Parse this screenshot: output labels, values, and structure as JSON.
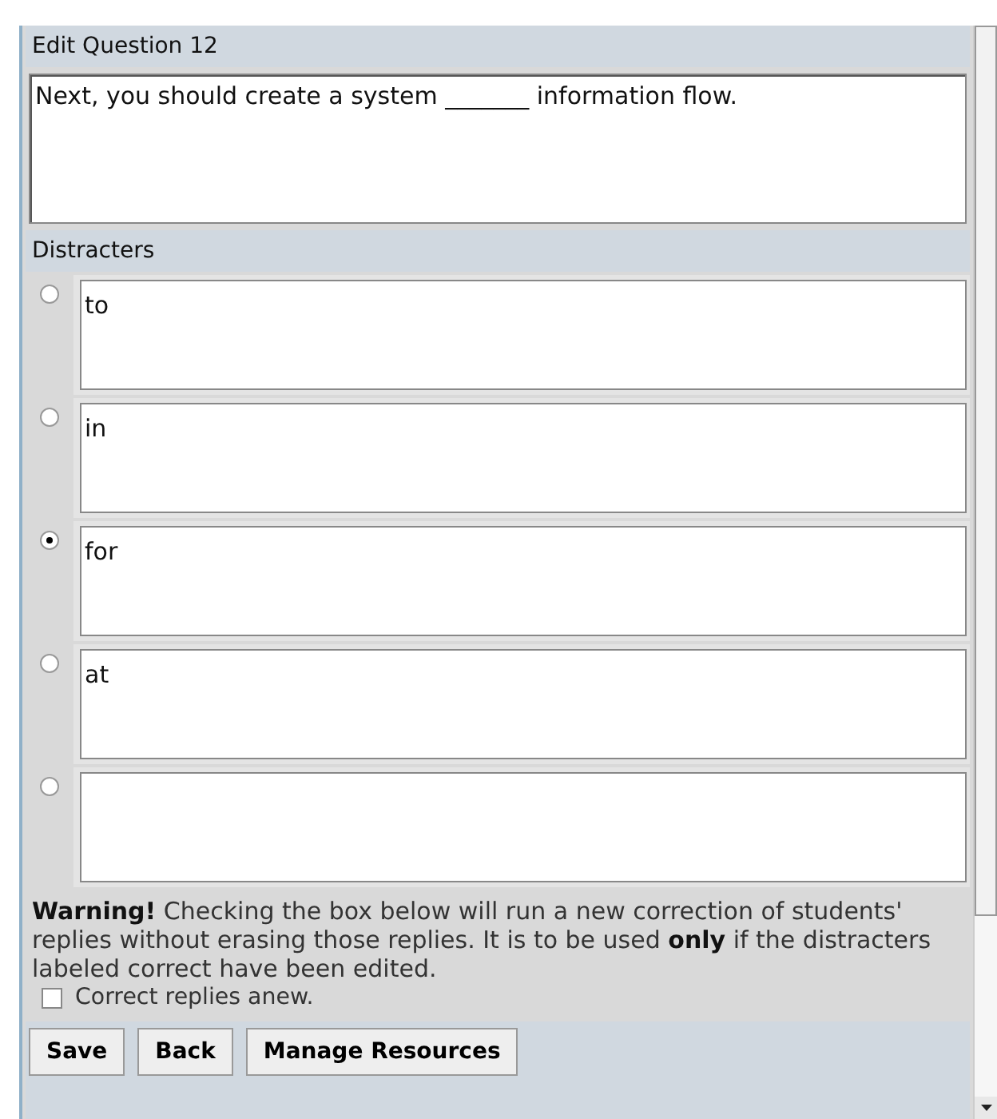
{
  "question": {
    "title": "Edit Question 12",
    "text": "Next, you should create a system _______ information flow."
  },
  "distracters": {
    "title": "Distracters",
    "items": [
      {
        "text": "to",
        "selected": false
      },
      {
        "text": "in",
        "selected": false
      },
      {
        "text": "for",
        "selected": true
      },
      {
        "text": "at",
        "selected": false
      },
      {
        "selected": false
      }
    ]
  },
  "warning": {
    "text": "**Warning!** Checking the box below will run a new correction of students' replies without erasing those replies. It is to be used **only** if the distracters labeled correct have been edited.",
    "checkbox": {
      "label": "Correct replies anew.",
      "checked": false
    }
  },
  "buttons": [
    "Save",
    "Back",
    "Manage Resources"
  ]
}
